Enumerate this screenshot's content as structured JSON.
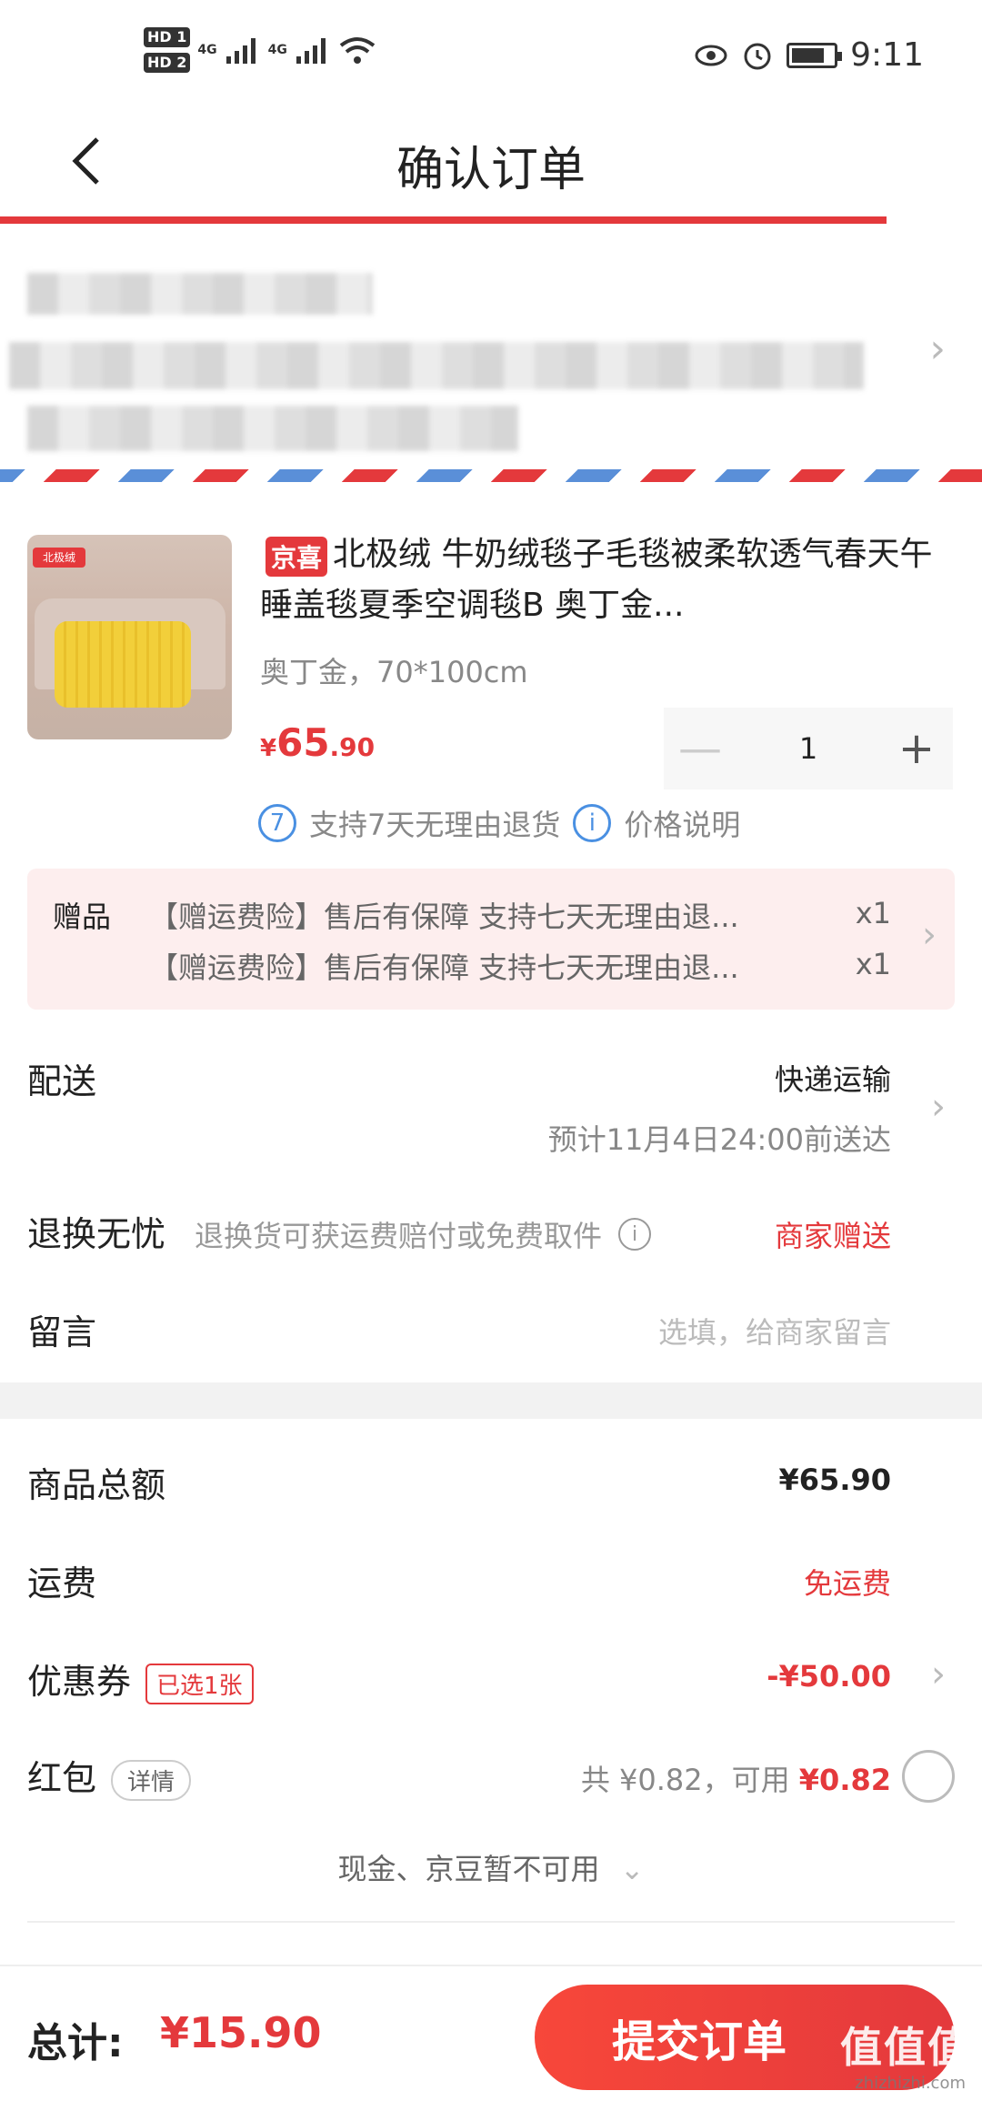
{
  "status_bar": {
    "hd1": "HD 1",
    "hd2": "HD 2",
    "net1": "4G",
    "net2": "4G",
    "time": "9:11",
    "icons": [
      "eye-icon",
      "alarm-icon",
      "battery-icon",
      "wifi-icon"
    ]
  },
  "header": {
    "title": "确认订单",
    "back_icon": "chevron-left-icon"
  },
  "product": {
    "tag": "京喜",
    "title": "北极绒 牛奶绒毯子毛毯被柔软透气春天午睡盖毯夏季空调毯B 奥丁金...",
    "spec": "奥丁金，70*100cm",
    "price_currency": "¥",
    "price_int": "65",
    "price_dec": ".90",
    "quantity": "1",
    "minus": "—",
    "plus": "+",
    "service_return_badge": "7",
    "service_return": "支持7天无理由退货",
    "service_price_badge": "i",
    "service_price": "价格说明"
  },
  "gifts": {
    "label": "赠品",
    "items": [
      {
        "text": "【赠运费险】售后有保障 支持七天无理由退...",
        "qty": "x1"
      },
      {
        "text": "【赠运费险】售后有保障 支持七天无理由退...",
        "qty": "x1"
      }
    ]
  },
  "delivery": {
    "label": "配送",
    "method": "快递运输",
    "eta": "预计11月4日24:00前送达"
  },
  "returns": {
    "label": "退换无忧",
    "desc": "退换货可获运费赔付或免费取件",
    "info_badge": "i",
    "value": "商家赠送"
  },
  "message": {
    "label": "留言",
    "placeholder": "选填，给商家留言"
  },
  "summary": {
    "goods_total_label": "商品总额",
    "goods_total_value": "¥65.90",
    "shipping_label": "运费",
    "shipping_value": "免运费",
    "coupon_label": "优惠券",
    "coupon_badge": "已选1张",
    "coupon_value": "-¥50.00",
    "redpacket_label": "红包",
    "redpacket_badge": "详情",
    "redpacket_total": "共 ¥0.82，可用",
    "redpacket_available": "¥0.82",
    "cash_note": "现金、京豆暂不可用"
  },
  "bottom": {
    "total_label": "总计:",
    "total_value": "¥15.90",
    "submit": "提交订单",
    "watermark": "值值值",
    "watermark_url": "zhizhizhi.com"
  },
  "colors": {
    "accent": "#e4393c",
    "info_blue": "#4a90e2",
    "gift_bg": "#fdeeee"
  }
}
